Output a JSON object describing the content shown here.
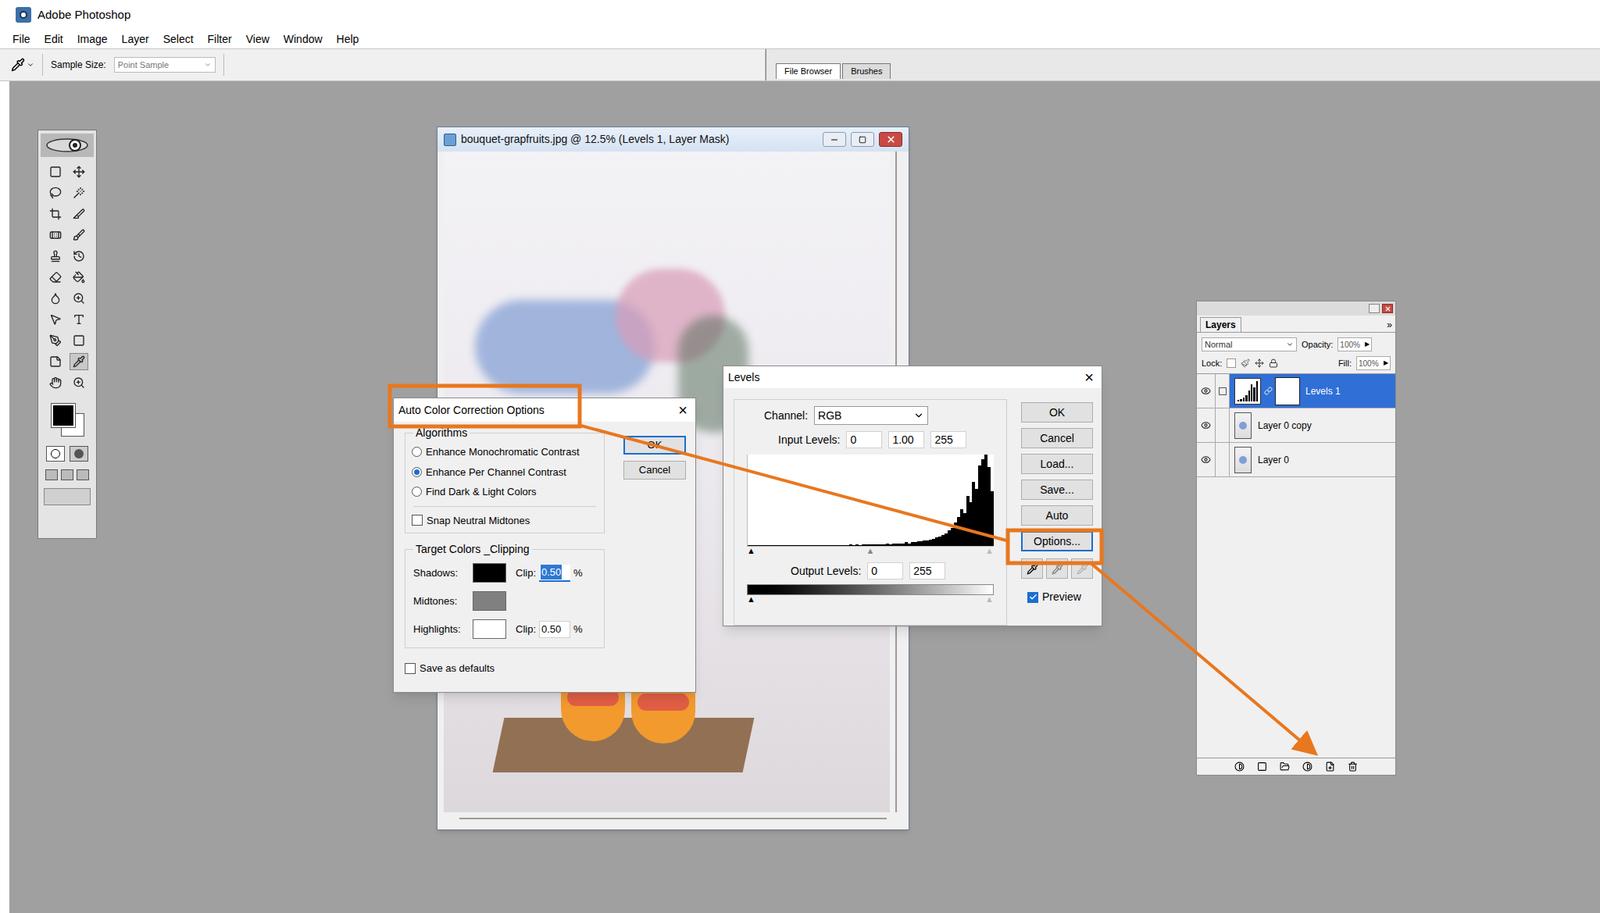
{
  "app": {
    "title": "Adobe Photoshop"
  },
  "menu": [
    "File",
    "Edit",
    "Image",
    "Layer",
    "Select",
    "Filter",
    "View",
    "Window",
    "Help"
  ],
  "options_bar": {
    "sample_size_label": "Sample Size:",
    "sample_size": "Point Sample"
  },
  "palette_well": {
    "tabs": [
      {
        "label": "File Browser",
        "selected": true
      },
      {
        "label": "Brushes",
        "selected": false
      }
    ]
  },
  "document": {
    "title": "bouquet-grapfruits.jpg @ 12.5% (Levels 1, Layer Mask)"
  },
  "levels": {
    "title": "Levels",
    "close": "×",
    "channel_label": "Channel:",
    "channel": "RGB",
    "input_label": "Input Levels:",
    "input": [
      "0",
      "1.00",
      "255"
    ],
    "output_label": "Output Levels:",
    "output": [
      "0",
      "255"
    ],
    "histogram": {
      "values": [
        1,
        1,
        1,
        1,
        1,
        1,
        1,
        1,
        1,
        1,
        1,
        1,
        1,
        1,
        1,
        1,
        1,
        1,
        1,
        1,
        1,
        1,
        1,
        1,
        1,
        1,
        1,
        1,
        1,
        1,
        1,
        1,
        1,
        2,
        1,
        2,
        1,
        2,
        2,
        2,
        2,
        2,
        2,
        2,
        2,
        3,
        2,
        3,
        3,
        3,
        3,
        4,
        3,
        4,
        4,
        5,
        5,
        6,
        6,
        7,
        8,
        9,
        10,
        12,
        14,
        17,
        20,
        26,
        32,
        40,
        36,
        55,
        48,
        70,
        62,
        88,
        95,
        100,
        86,
        60
      ]
    },
    "buttons": [
      {
        "label": "OK",
        "highlighted": false
      },
      {
        "label": "Cancel",
        "highlighted": false
      },
      {
        "label": "Load...",
        "highlighted": false
      },
      {
        "label": "Save...",
        "highlighted": false
      },
      {
        "label": "Auto",
        "highlighted": false
      },
      {
        "label": "Options...",
        "highlighted": true
      }
    ],
    "preview": {
      "label": "Preview",
      "checked": true
    }
  },
  "auto_color": {
    "title": "Auto Color Correction Options",
    "close": "×",
    "highlighted": true,
    "algorithms_label": "Algorithms",
    "algorithms": [
      {
        "label": "Enhance Monochromatic Contrast",
        "selected": false
      },
      {
        "label": "Enhance Per Channel Contrast",
        "selected": true
      },
      {
        "label": "Find Dark & Light Colors",
        "selected": false
      }
    ],
    "snap": {
      "label": "Snap Neutral Midtones",
      "checked": false
    },
    "targets_label": "Target Colors _Clipping",
    "targets": [
      {
        "label": "Shadows:",
        "kind": "clip",
        "color": "#000000",
        "clip_label": "Clip:",
        "clip": "0.50",
        "unit": "%",
        "focused": true
      },
      {
        "label": "Midtones:",
        "kind": "plain",
        "color": "#808080"
      },
      {
        "label": "Highlights:",
        "kind": "clip",
        "color": "#ffffff",
        "clip_label": "Clip:",
        "clip": "0.50",
        "unit": "%",
        "focused": false
      }
    ],
    "save_defaults": {
      "label": "Save as defaults",
      "checked": false
    },
    "buttons": [
      {
        "label": "OK",
        "default": true
      },
      {
        "label": "Cancel",
        "default": false
      }
    ]
  },
  "layers": {
    "tab": "Layers",
    "more": "»",
    "blend_mode": "Normal",
    "opacity_label": "Opacity:",
    "opacity": "100%",
    "lock_label": "Lock:",
    "fill_label": "Fill:",
    "fill": "100%",
    "items": [
      {
        "name": "Levels 1",
        "kind": "adjustment",
        "visible": true,
        "selected": true
      },
      {
        "name": "Layer 0 copy",
        "kind": "pixel",
        "visible": true,
        "selected": false
      },
      {
        "name": "Layer 0",
        "kind": "pixel",
        "visible": true,
        "selected": false
      }
    ]
  }
}
